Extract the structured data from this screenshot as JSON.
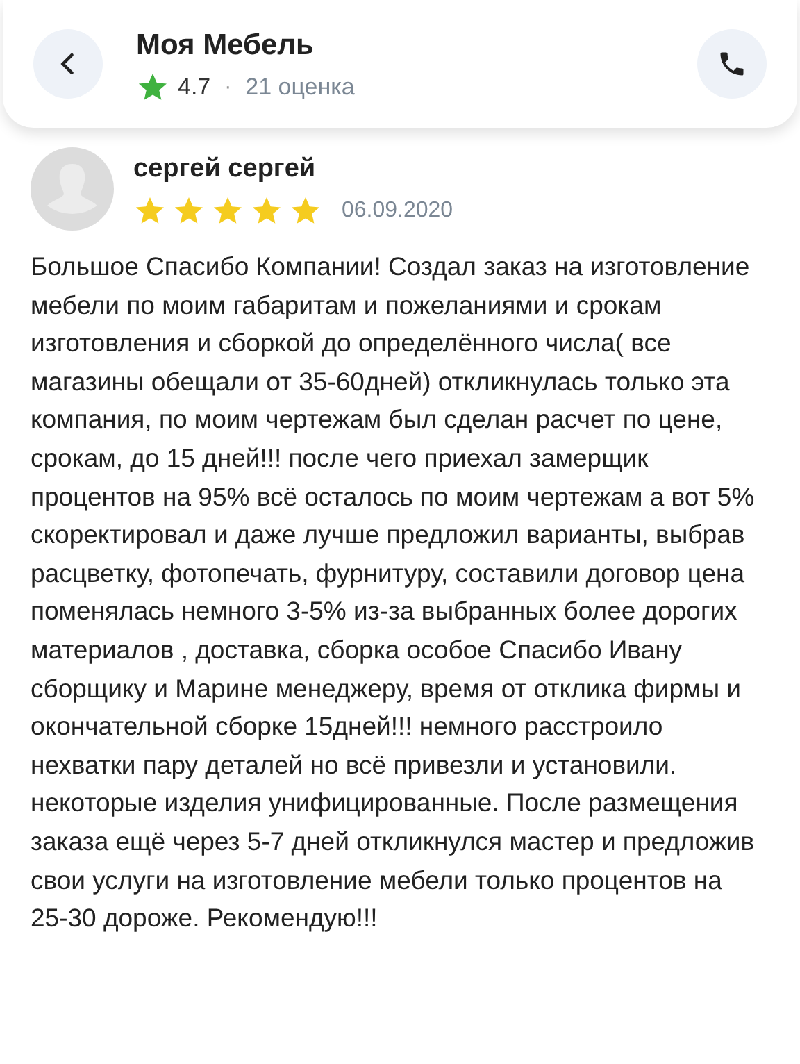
{
  "header": {
    "title": "Моя Мебель",
    "rating": "4.7",
    "separator": "·",
    "reviews_count": "21 оценка"
  },
  "review": {
    "author": "сергей сергей",
    "stars": 5,
    "date": "06.09.2020",
    "text": "Большое Спасибо Компании! Создал заказ на изготовление мебели по моим габаритам и пожеланиями и срокам изготовления и сборкой до определённого числа( все магазины обещали от 35-60дней) откликнулась только эта компания, по моим чертежам был сделан расчет по цене, срокам, до 15 дней!!! после чего приехал замерщик процентов на 95% всё осталось по моим чертежам а вот 5% скоректировал и даже лучше предложил варианты, выбрав расцветку, фотопечать, фурнитуру, составили договор цена поменялась немного 3-5% из-за выбранных более дорогих материалов , доставка, сборка особое Спасибо Ивану сборщику и Марине менеджеру, время от отклика фирмы и окончательной сборке 15дней!!! немного расстроило нехватки пару деталей но всё привезли и установили. некоторые изделия унифицированные. После размещения заказа ещё через 5-7 дней откликнулся мастер и предложив свои услуги на изготовление мебели только процентов на 25-30 дороже. Рекомендую!!!"
  }
}
